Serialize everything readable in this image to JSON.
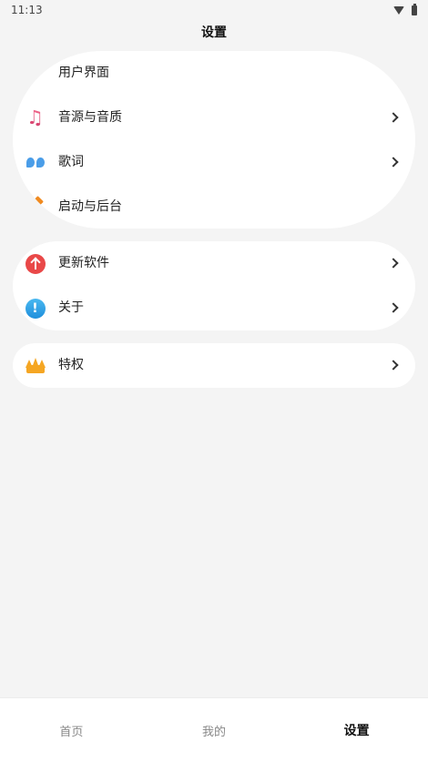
{
  "status_bar": {
    "time": "11:13",
    "icons": [
      "wifi-icon",
      "battery-icon"
    ]
  },
  "header": {
    "title": "设置"
  },
  "settings": {
    "group1": [
      {
        "label": "用户界面",
        "icon": "palette-icon",
        "chevron": false
      },
      {
        "label": "音源与音质",
        "icon": "music-note-icon",
        "chevron": true
      },
      {
        "label": "歌词",
        "icon": "quote-icon",
        "chevron": true
      },
      {
        "label": "启动与后台",
        "icon": "launch-icon",
        "chevron": false
      }
    ],
    "group2": [
      {
        "label": "更新软件",
        "icon": "update-arrow-icon",
        "chevron": true
      },
      {
        "label": "关于",
        "icon": "info-icon",
        "chevron": true
      }
    ],
    "group3": [
      {
        "label": "特权",
        "icon": "crown-icon",
        "chevron": true
      }
    ]
  },
  "icon_glyphs": {
    "music": "♫",
    "info": "!"
  },
  "bottom_nav": {
    "items": [
      {
        "label": "首页",
        "active": false
      },
      {
        "label": "我的",
        "active": false
      },
      {
        "label": "设置",
        "active": true
      }
    ]
  },
  "colors": {
    "background": "#f4f4f4",
    "card": "#ffffff",
    "update_red": "#e94848",
    "info_blue": "#1f8fdc",
    "crown_orange": "#f5a623",
    "music_pink": "#e24e7a"
  }
}
